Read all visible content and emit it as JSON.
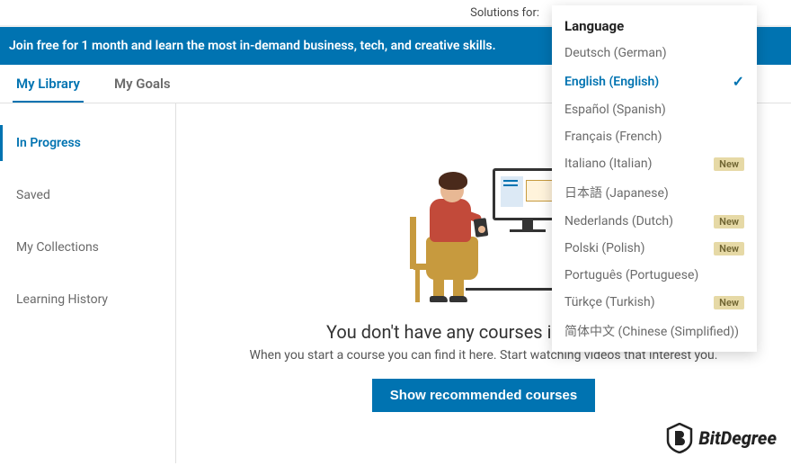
{
  "topnav": {
    "solutions_label": "Solutions for:"
  },
  "banner": {
    "text": "Join free for 1 month and learn the most in-demand business, tech, and creative skills."
  },
  "tabs": [
    {
      "label": "My Library",
      "active": true
    },
    {
      "label": "My Goals",
      "active": false
    }
  ],
  "sidebar": {
    "items": [
      {
        "label": "In Progress",
        "active": true
      },
      {
        "label": "Saved",
        "active": false
      },
      {
        "label": "My Collections",
        "active": false
      },
      {
        "label": "Learning History",
        "active": false
      }
    ]
  },
  "empty_state": {
    "headline": "You don't have any courses in progress.",
    "subline": "When you start a course you can find it here. Start watching videos that interest you.",
    "cta": "Show recommended courses"
  },
  "language_menu": {
    "title": "Language",
    "new_badge": "New",
    "items": [
      {
        "label": "Deutsch (German)",
        "selected": false,
        "new": false
      },
      {
        "label": "English (English)",
        "selected": true,
        "new": false
      },
      {
        "label": "Español (Spanish)",
        "selected": false,
        "new": false
      },
      {
        "label": "Français (French)",
        "selected": false,
        "new": false
      },
      {
        "label": "Italiano (Italian)",
        "selected": false,
        "new": true
      },
      {
        "label": "日本語 (Japanese)",
        "selected": false,
        "new": false
      },
      {
        "label": "Nederlands (Dutch)",
        "selected": false,
        "new": true
      },
      {
        "label": "Polski (Polish)",
        "selected": false,
        "new": true
      },
      {
        "label": "Português (Portuguese)",
        "selected": false,
        "new": false
      },
      {
        "label": "Türkçe (Turkish)",
        "selected": false,
        "new": true
      },
      {
        "label": "简体中文 (Chinese (Simplified))",
        "selected": false,
        "new": false
      }
    ]
  },
  "watermark": {
    "text": "BitDegree"
  }
}
